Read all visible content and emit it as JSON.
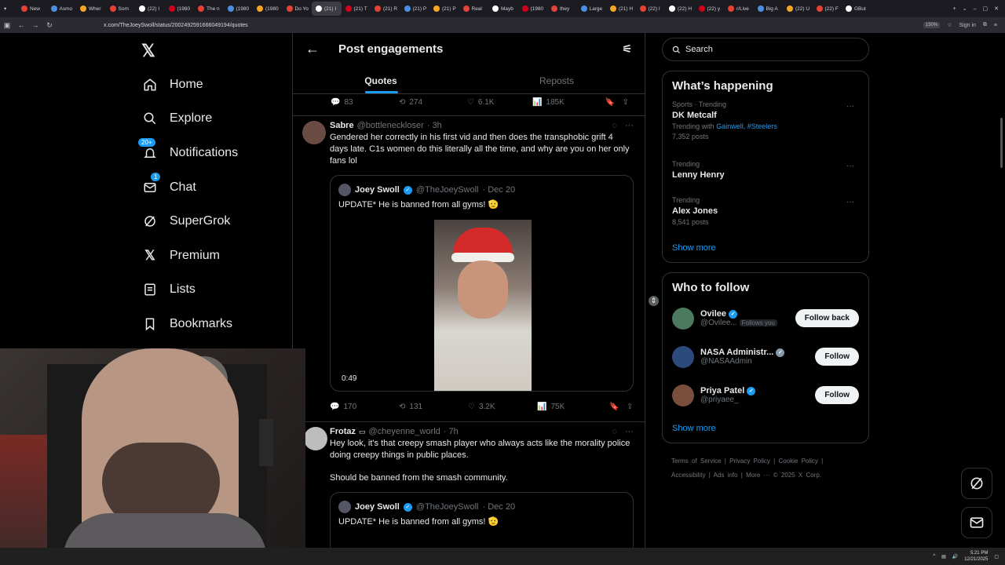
{
  "browser": {
    "tabs": [
      "New",
      "Asmo",
      "Wher",
      "Som",
      "(22) I",
      "(1980",
      "The n",
      "(1980",
      "(1980",
      "Do Yo",
      "(21) I",
      "(21) T",
      "(21) R",
      "(21) P",
      "(21) P",
      "Real",
      "Mayb",
      "(1980",
      "they",
      "Large",
      "(21) H",
      "(22) I",
      "(22) H",
      "(22) y",
      "r/Live",
      "Big A",
      "(22) U",
      "(22) F",
      "GBut"
    ],
    "active_tab_index": 10,
    "url": "x.com/TheJoeySwoll/status/2002492591666049194/quotes",
    "zoom": "150%",
    "signin": "Sign in"
  },
  "nav": {
    "items": [
      {
        "label": "Home",
        "icon": "home-icon"
      },
      {
        "label": "Explore",
        "icon": "search-icon"
      },
      {
        "label": "Notifications",
        "icon": "bell-icon",
        "badge": "20+"
      },
      {
        "label": "Chat",
        "icon": "mail-icon",
        "badge": "1"
      },
      {
        "label": "SuperGrok",
        "icon": "grok-icon"
      },
      {
        "label": "Premium",
        "icon": "x-icon"
      },
      {
        "label": "Lists",
        "icon": "list-icon"
      },
      {
        "label": "Bookmarks",
        "icon": "bookmark-icon"
      }
    ]
  },
  "main": {
    "title": "Post engagements",
    "tabs": [
      "Quotes",
      "Reposts"
    ],
    "top_actions": {
      "replies": "83",
      "reposts": "274",
      "likes": "6.1K",
      "views": "185K"
    },
    "posts": [
      {
        "name": "Sabre",
        "handle": "@bottleneckloser",
        "time": "· 3h",
        "text": "Gendered her correctly in his first vid and then does the transphobic grift 4 days late. C1s women do this literally all the time, and why are you on her only fans lol",
        "quote": {
          "name": "Joey Swoll",
          "handle": "@TheJoeySwoll",
          "date": "· Dec 20",
          "text": "UPDATE* He is banned from all gyms! 🫡",
          "duration": "0:49"
        },
        "actions": {
          "replies": "170",
          "reposts": "131",
          "likes": "3.2K",
          "views": "75K"
        }
      },
      {
        "name": "Frotaz",
        "handle": "@cheyenne_world",
        "time": "· 7h",
        "text": "Hey look, it's that creepy smash player who always acts like the morality police doing creepy things in public places.",
        "text2": "Should be banned from the smash community.",
        "quote": {
          "name": "Joey Swoll",
          "handle": "@TheJoeySwoll",
          "date": "· Dec 20",
          "text": "UPDATE* He is banned from all gyms! 🫡"
        }
      }
    ]
  },
  "right": {
    "search_placeholder": "Search",
    "happening_title": "What’s happening",
    "trends": [
      {
        "meta": "Sports · Trending",
        "title": "DK Metcalf",
        "with_label": "Trending with",
        "with": "Gainwell, #Steelers",
        "count": "7,352 posts"
      },
      {
        "meta": "Trending",
        "title": "Lenny Henry"
      },
      {
        "meta": "Trending",
        "title": "Alex Jones",
        "count": "8,541 posts"
      }
    ],
    "show_more": "Show more",
    "who_title": "Who to follow",
    "follow": [
      {
        "name": "Ovilee",
        "handle": "@Ovilee...",
        "note": "Follows you",
        "button": "Follow back",
        "avatar_color": "#4b7a5e"
      },
      {
        "name": "NASA Administr...",
        "handle": "@NASAAdmin",
        "button": "Follow",
        "avatar_color": "#2d4a7c"
      },
      {
        "name": "Priya Patel",
        "handle": "@priyaee_",
        "button": "Follow",
        "avatar_color": "#7a4e3c"
      }
    ],
    "show_more2": "Show more",
    "footer": [
      "Terms of Service",
      "Privacy Policy",
      "Cookie Policy",
      "Accessibility",
      "Ads info",
      "More ···",
      "© 2025 X Corp."
    ]
  },
  "taskbar": {
    "time": "5:21 PM",
    "date": "12/21/2025"
  }
}
